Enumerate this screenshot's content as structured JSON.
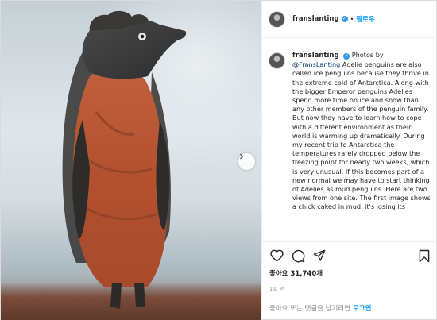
{
  "header": {
    "username": "franslanting",
    "verified_badge": "✓",
    "separator": "•",
    "follow_label": "팔로우"
  },
  "caption": {
    "username": "franslanting",
    "verified_badge": "✓",
    "text_before_mention": "Photos by",
    "mention": "@FransLanting",
    "text_after_mention": "Adelie penguins are also called ice penguins because they thrive in the extreme cold of Antarctica. Along with the bigger Emperor penguins Adelies spend more time on ice and snow than any other members of the penguin family. But now they have to learn how to cope with a different environment as their world is warming up dramatically. During my recent trip to Antarctica the temperatures rarely dropped below the freezing point for nearly two weeks, which is very unusual. If this becomes part of a new normal we may have to start thinking of Adelies as mud penguins. Here are two views from one site. The first image shows a chick caked in mud. it's losing its"
  },
  "actions": {
    "like_icon": "heart-icon",
    "comment_icon": "comment-icon",
    "share_icon": "paper-plane-icon",
    "save_icon": "bookmark-icon",
    "next_icon": "chevron-right-icon"
  },
  "likes": {
    "label": "좋아요",
    "count": "31,740개"
  },
  "date": "1일 전",
  "login_bar": {
    "prompt": "좋아요 또는 댓글을 남기려면",
    "login_label": "로그인"
  },
  "colors": {
    "accent": "#0095f6",
    "verified": "#3897f0",
    "text": "#262626",
    "muted": "#8e8e8e",
    "border": "#dbdbdb"
  }
}
